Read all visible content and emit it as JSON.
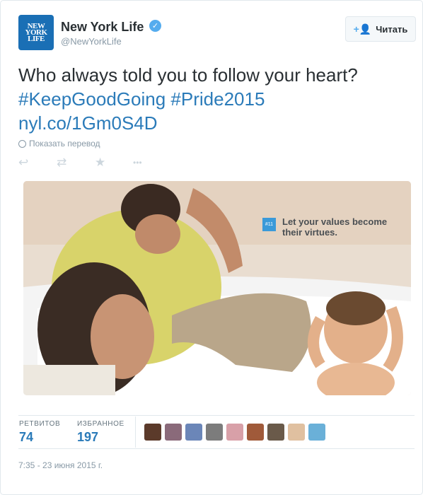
{
  "account": {
    "name": "New York Life",
    "handle": "@NewYorkLife",
    "logo_lines": [
      "NEW",
      "YORK",
      "LIFE"
    ]
  },
  "follow_button": {
    "label": "Читать",
    "icon": "add-user-icon"
  },
  "tweet": {
    "text": "Who always told you to follow your heart?",
    "hashtags": [
      "#KeepGoodGoing",
      "#Pride2015"
    ],
    "link": "nyl.co/1Gm0S4D",
    "translate_label": "Показать перевод"
  },
  "actions": [
    {
      "name": "reply",
      "icon": "reply-icon",
      "glyph": "↩"
    },
    {
      "name": "retweet",
      "icon": "retweet-icon",
      "glyph": "⇄"
    },
    {
      "name": "favorite",
      "icon": "star-icon",
      "glyph": "★"
    },
    {
      "name": "more",
      "icon": "more-icon",
      "glyph": "•••"
    }
  ],
  "media": {
    "badge": "#11",
    "tagline": "Let your values become their virtues."
  },
  "stats": {
    "retweets_label": "РЕТВИТОВ",
    "retweets": "74",
    "favorites_label": "ИЗБРАННОЕ",
    "favorites": "197"
  },
  "avatar_colors": [
    "#5b3a2a",
    "#8a6a7a",
    "#6b86b8",
    "#7c7c7c",
    "#d8a0a8",
    "#a05a3a",
    "#6a5a4a",
    "#e0c0a0",
    "#6ab0d8"
  ],
  "timestamp": "7:35 - 23 июня 2015 г."
}
